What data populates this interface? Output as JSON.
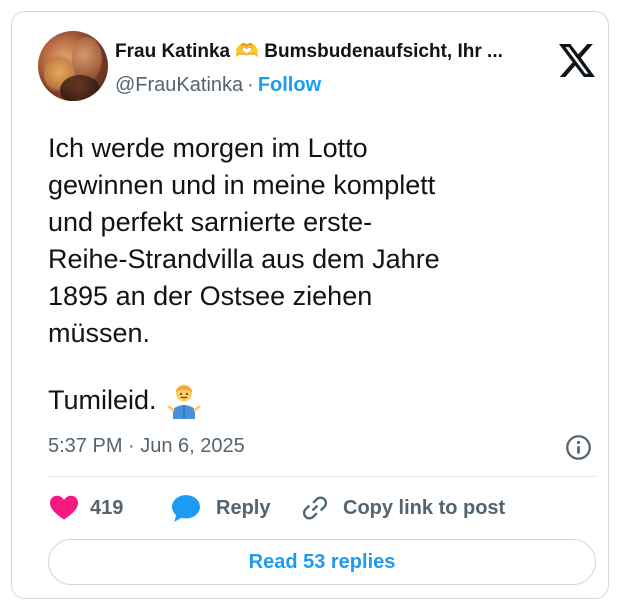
{
  "author": {
    "name": "Frau Katinka 🫶 Bumsbudenaufsicht, Ihr ...",
    "handle": "@FrauKatinka",
    "separator": "·",
    "follow_label": "Follow"
  },
  "platform_icon": "x-logo-icon",
  "tweet": {
    "text": "Ich werde morgen im Lotto\ngewinnen und in meine komplett\nund perfekt sarnierte erste-\nReihe-Strandvilla aus dem Jahre\n1895 an der Ostsee ziehen\nmüssen.",
    "text2": "Tumileid.",
    "emoji": "person-shrugging-emoji",
    "timestamp": "5:37 PM · Jun 6, 2025"
  },
  "actions": {
    "like_count": "419",
    "reply_label": "Reply",
    "copy_label": "Copy link to post"
  },
  "read_replies_label": "Read 53 replies",
  "colors": {
    "accent": "#1d9bf0",
    "like": "#f91880",
    "secondary_text": "#536471",
    "border": "#cfd9de"
  }
}
